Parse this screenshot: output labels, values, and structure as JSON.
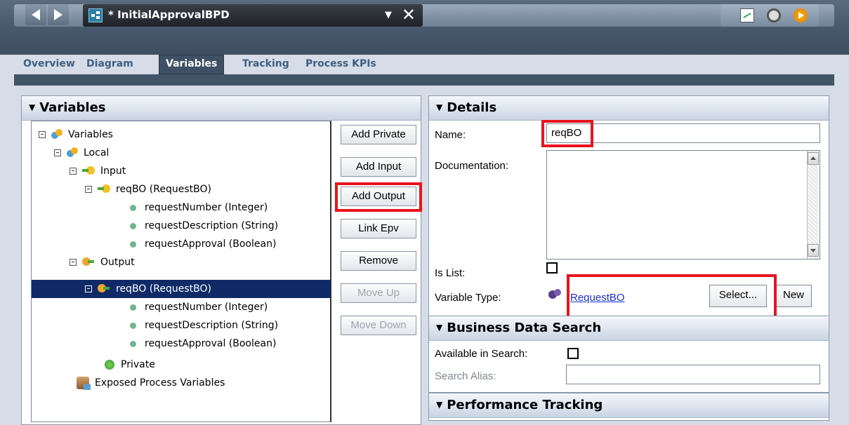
{
  "window": {
    "document_title": "* InitialApprovalBPD",
    "icons": [
      "back-icon",
      "forward-icon",
      "bpd-icon",
      "dropdown-icon",
      "close-icon",
      "chart-icon",
      "inspector-icon",
      "run-icon"
    ]
  },
  "tabs": [
    {
      "label": "Overview"
    },
    {
      "label": "Diagram"
    },
    {
      "label": "Variables",
      "active": true
    },
    {
      "label": "Tracking"
    },
    {
      "label": "Process KPIs"
    }
  ],
  "variables_panel": {
    "title": "Variables",
    "tree": [
      {
        "label": "Variables",
        "icon": "variables-icon"
      },
      {
        "label": "Local",
        "icon": "variables-icon"
      },
      {
        "label": "Input",
        "icon": "input-icon"
      },
      {
        "label": "reqBO (RequestBO)",
        "icon": "input-icon"
      },
      {
        "label": "requestNumber (Integer)"
      },
      {
        "label": "requestDescription (String)"
      },
      {
        "label": "requestApproval (Boolean)"
      },
      {
        "label": "Output",
        "icon": "output-icon"
      },
      {
        "label": "reqBO (RequestBO)",
        "icon": "output-icon",
        "selected": true
      },
      {
        "label": "requestNumber (Integer)"
      },
      {
        "label": "requestDescription (String)"
      },
      {
        "label": "requestApproval (Boolean)"
      },
      {
        "label": "Private",
        "icon": "private-icon"
      },
      {
        "label": "Exposed Process Variables",
        "icon": "exposed-variables-icon"
      }
    ],
    "buttons": {
      "add_private": "Add Private",
      "add_input": "Add Input",
      "add_output": "Add Output",
      "link_epv": "Link Epv",
      "remove": "Remove",
      "move_up": "Move Up",
      "move_down": "Move Down"
    }
  },
  "details_panel": {
    "title": "Details",
    "name_label": "Name:",
    "name_value": "reqBO",
    "documentation_label": "Documentation:",
    "documentation_value": "",
    "is_list_label": "Is List:",
    "is_list_checked": false,
    "variable_type_label": "Variable Type:",
    "variable_type_value": "RequestBO",
    "select_button": "Select...",
    "new_button": "New"
  },
  "business_data_search": {
    "title": "Business Data Search",
    "available_label": "Available in Search:",
    "available_checked": false,
    "alias_label": "Search Alias:",
    "alias_value": ""
  },
  "performance_tracking": {
    "title": "Performance Tracking"
  },
  "colors": {
    "highlight": "#e8141e",
    "selection": "#0f2a66",
    "link": "#1a2fd6"
  }
}
